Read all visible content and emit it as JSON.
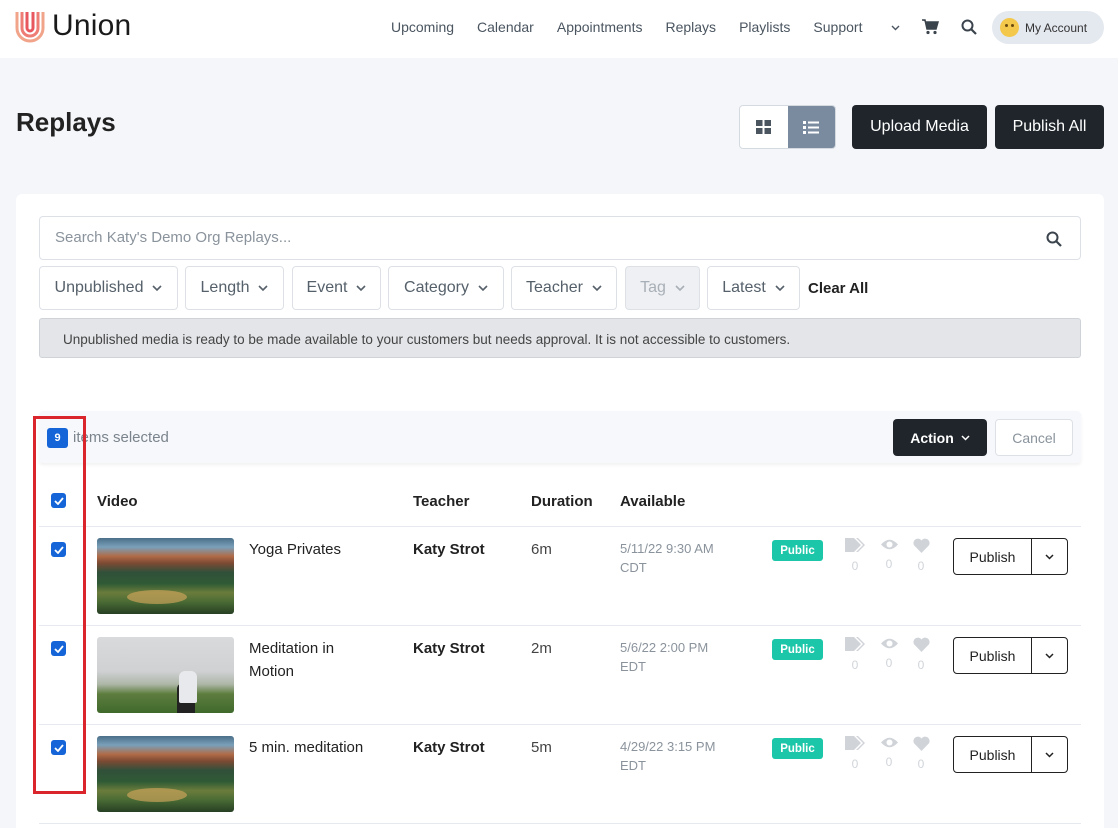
{
  "header": {
    "brand": "Union",
    "nav": [
      {
        "label": "Upcoming"
      },
      {
        "label": "Calendar"
      },
      {
        "label": "Appointments"
      },
      {
        "label": "Replays"
      },
      {
        "label": "Playlists"
      },
      {
        "label": "Support"
      }
    ],
    "account_label": "My Account"
  },
  "page": {
    "title": "Replays",
    "upload_label": "Upload Media",
    "publish_all_label": "Publish All"
  },
  "search": {
    "placeholder": "Search Katy's Demo Org Replays..."
  },
  "filters": [
    {
      "label": "Unpublished"
    },
    {
      "label": "Length"
    },
    {
      "label": "Event"
    },
    {
      "label": "Category"
    },
    {
      "label": "Teacher"
    },
    {
      "label": "Tag",
      "disabled": true
    },
    {
      "label": "Latest"
    }
  ],
  "clear_all_label": "Clear All",
  "notice": "Unpublished media is ready to be made available to your customers but needs approval. It is not accessible to customers.",
  "selection": {
    "count": "9",
    "text": "items selected",
    "action_label": "Action",
    "cancel_label": "Cancel"
  },
  "table": {
    "headers": {
      "video": "Video",
      "teacher": "Teacher",
      "duration": "Duration",
      "available": "Available"
    },
    "rows": [
      {
        "title_line1": "Yoga Privates",
        "title_line2": "",
        "teacher": "Katy Strot",
        "duration": "6m",
        "date": "5/11/22 9:30 AM",
        "tz": "CDT",
        "badge": "Public",
        "tags": "0",
        "views": "0",
        "likes": "0",
        "publish_label": "Publish"
      },
      {
        "title_line1": "Meditation in",
        "title_line2": "Motion",
        "teacher": "Katy Strot",
        "duration": "2m",
        "date": "5/6/22 2:00 PM",
        "tz": "EDT",
        "badge": "Public",
        "tags": "0",
        "views": "0",
        "likes": "0",
        "publish_label": "Publish"
      },
      {
        "title_line1": "5 min. meditation",
        "title_line2": "",
        "teacher": "Katy Strot",
        "duration": "5m",
        "date": "4/29/22 3:15 PM",
        "tz": "EDT",
        "badge": "Public",
        "tags": "0",
        "views": "0",
        "likes": "0",
        "publish_label": "Publish"
      }
    ]
  },
  "colors": {
    "primary_blue": "#1565d8",
    "public_green": "#1cc6a8",
    "dark_button": "#1f252b",
    "highlight_red": "#d9252b"
  }
}
